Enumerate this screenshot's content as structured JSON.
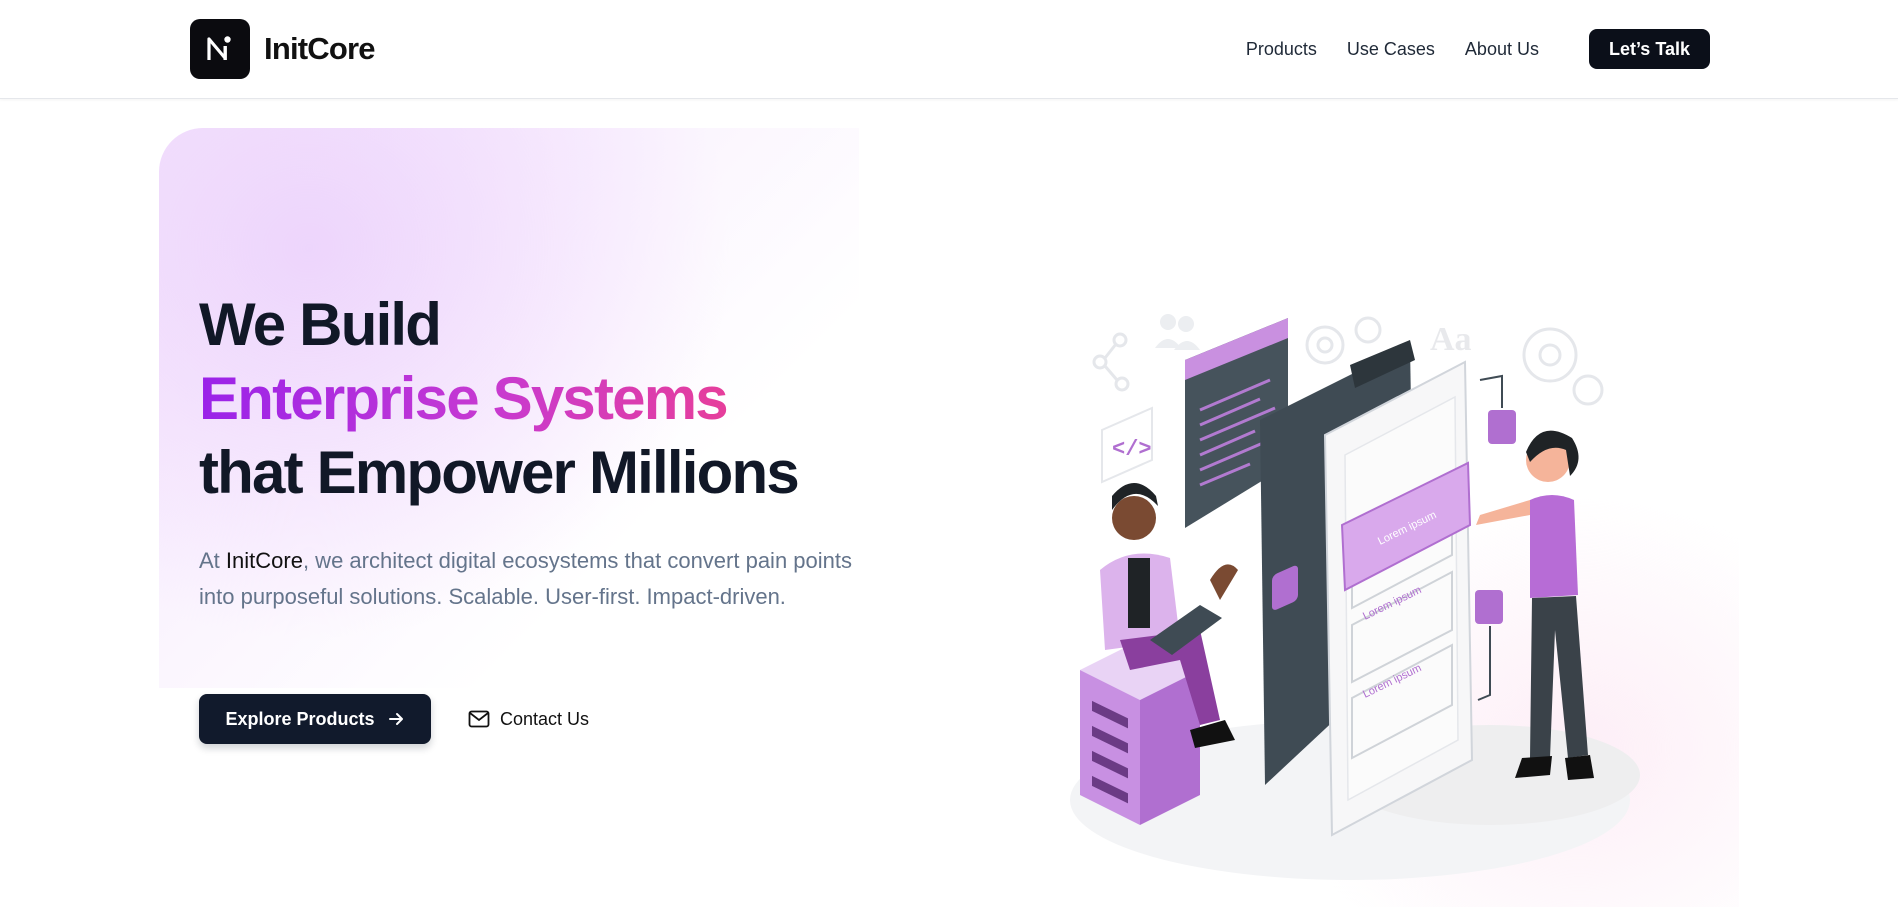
{
  "header": {
    "brand": "InitCore",
    "nav": [
      "Products",
      "Use Cases",
      "About Us"
    ],
    "cta": "Let’s Talk"
  },
  "hero": {
    "title_line1": "We Build",
    "title_line2": "Enterprise Systems",
    "title_line3": "that Empower Millions",
    "desc_prefix": "At ",
    "desc_brand": "InitCore",
    "desc_rest": ", we architect digital ecosystems that convert pain points into purposeful solutions. Scalable. User-first. Impact-driven.",
    "primary_button": "Explore Products",
    "secondary_button": "Contact Us"
  },
  "illustration": {
    "card_text_1": "Lorem ipsum",
    "card_text_2": "Lorem ipsum",
    "card_text_3": "Lorem ipsum",
    "deco_letters": "Aa"
  },
  "colors": {
    "accent_purple": "#9a22e9",
    "accent_pink": "#e63e9b",
    "dark": "#111a2c",
    "illustration_purple": "#b76cd6"
  }
}
